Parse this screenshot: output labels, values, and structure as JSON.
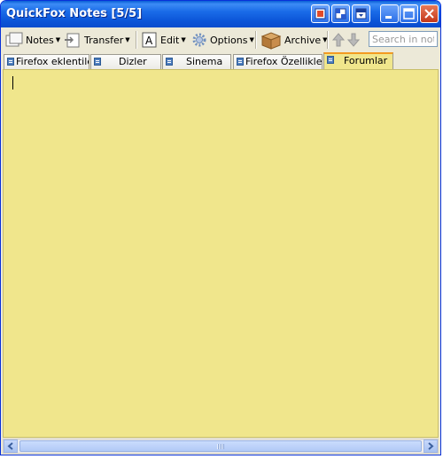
{
  "window": {
    "title": "QuickFox Notes [5/5]"
  },
  "toolbar": {
    "notes_label": "Notes",
    "transfer_label": "Transfer",
    "edit_label": "Edit",
    "options_label": "Options",
    "archive_label": "Archive",
    "search_placeholder": "Search in note"
  },
  "tabs": [
    {
      "label": "Firefox eklentiler",
      "active": false
    },
    {
      "label": "Dizler",
      "active": false
    },
    {
      "label": "Sinema",
      "active": false
    },
    {
      "label": "Firefox Özellikleri",
      "active": false
    },
    {
      "label": "Forumlar",
      "active": true
    }
  ],
  "note": {
    "content": ""
  },
  "colors": {
    "note_background": "#f0e68c",
    "active_tab_accent": "#f39b21",
    "titlebar": "#0a55d8"
  }
}
